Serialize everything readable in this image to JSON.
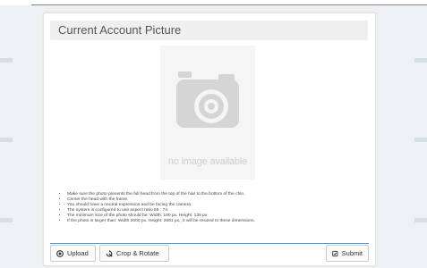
{
  "panel": {
    "title": "Current Account Picture"
  },
  "photo": {
    "placeholder_text": "no image available",
    "icon": "camera-icon"
  },
  "guidelines": [
    "Make sure the photo presents the full head from the top of the hair to the bottom of the chin.",
    "Center the head with the frame.",
    "You should have a neutral expression and be facing the camera.",
    "The system is configured to use aspect ratio 55 : 74.",
    "The minimum size of the photo should be: Width: 100 px. Height: 135 px.",
    "If the photo is larger than: Width 2000 px. Height: 2691 px., it will be resized to these dimensions."
  ],
  "actions": {
    "upload_label": "Upload",
    "upload_icon": "upload-circle-icon",
    "crop_label": "Crop & Rotate",
    "crop_icon": "crop-icon",
    "submit_label": "Submit",
    "submit_icon": "check-square-icon"
  },
  "colors": {
    "accent": "#5b8fbd",
    "header_bg": "#efefef",
    "placeholder_bg": "#f5f5f5",
    "placeholder_icon": "#d5d5d5"
  }
}
